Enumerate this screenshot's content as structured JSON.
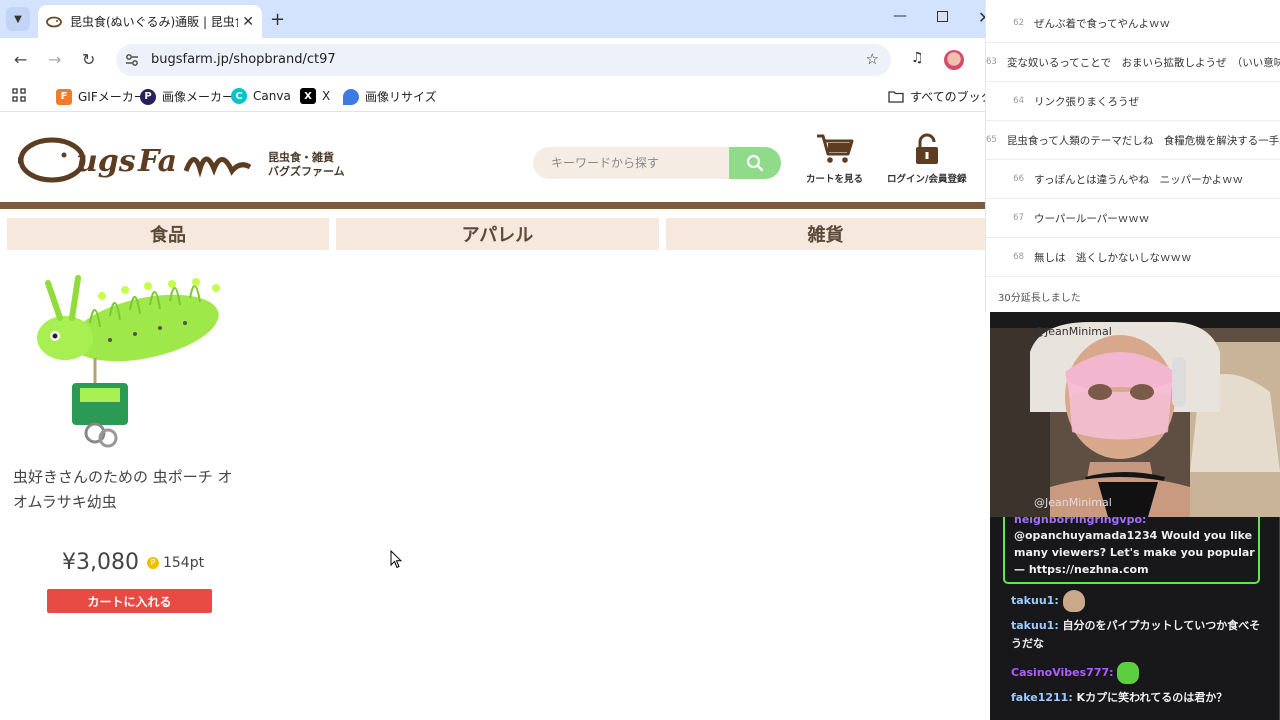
{
  "browser": {
    "tab_title": "昆虫食(ぬいぐるみ)通販 | 昆虫食(",
    "url": "bugsfarm.jp/shopbrand/ct97",
    "bookmarks": [
      {
        "label": "GIFメーカー",
        "icon": "gif-maker-icon",
        "color": "#f07b2d"
      },
      {
        "label": "画像メーカー",
        "icon": "image-maker-icon",
        "color": "#2a1f5c"
      },
      {
        "label": "Canva",
        "icon": "canva-icon",
        "color": "#00c4cc"
      },
      {
        "label": "X",
        "icon": "x-icon",
        "color": "#000000"
      },
      {
        "label": "画像リサイズ",
        "icon": "image-resize-icon",
        "color": "#3d7be0"
      }
    ],
    "all_bookmarks": "すべてのブックマー"
  },
  "site": {
    "logo_text": "Bugs Farm",
    "logo_sub_line1": "昆虫食・雑貨",
    "logo_sub_line2": "バグズファーム",
    "search_placeholder": "キーワードから探す",
    "cart_label": "カートを見る",
    "login_label": "ログイン/会員登録",
    "categories": [
      "食品",
      "アパレル",
      "雑貨"
    ],
    "accent_color": "#7d5a3c"
  },
  "product": {
    "name": "虫好きさんのための 虫ポーチ オオムラサキ幼虫",
    "price": "¥3,080",
    "points_coin": "P",
    "points": "154pt",
    "add_to_cart": "カートに入れる"
  },
  "comments": {
    "items": [
      {
        "num": "62",
        "text": "ぜんぶ着で食ってやんよｗｗ"
      },
      {
        "num": "63",
        "text": "変な奴いるってことで　おまいら拡散しようぜ　（いい意味"
      },
      {
        "num": "64",
        "text": "リンク張りまくろうぜ"
      },
      {
        "num": "65",
        "text": "昆虫食って人類のテーマだしね　食糧危機を解決する一手段"
      },
      {
        "num": "66",
        "text": "すっぽんとは違うんやね　ニッパーかよｗｗ"
      },
      {
        "num": "67",
        "text": "ウーパールーパーｗｗｗ"
      },
      {
        "num": "68",
        "text": "無しは　逃くしかないしなｗｗｗ"
      }
    ],
    "footer": "30分延長しました"
  },
  "stream": {
    "handle": "@JeanMinimal"
  },
  "chat": {
    "highlight_user": "neighborringringvpo:",
    "highlight_text": "@opanchuyamada1234 Would you like many viewers? Let's make you popular — https://nezhna.com",
    "messages": [
      {
        "user": "takuu1",
        "user_color": "#9ecbff",
        "text": ""
      },
      {
        "user": "takuu1",
        "user_color": "#9ecbff",
        "text": "自分のをパイプカットしていつか食べそうだな"
      },
      {
        "user": "CasinoVibes777",
        "user_color": "#b05cff",
        "text": ""
      },
      {
        "user": "fake1211",
        "user_color": "#9ecbff",
        "text": "Kカプに笑われてるのは君か？"
      }
    ]
  }
}
